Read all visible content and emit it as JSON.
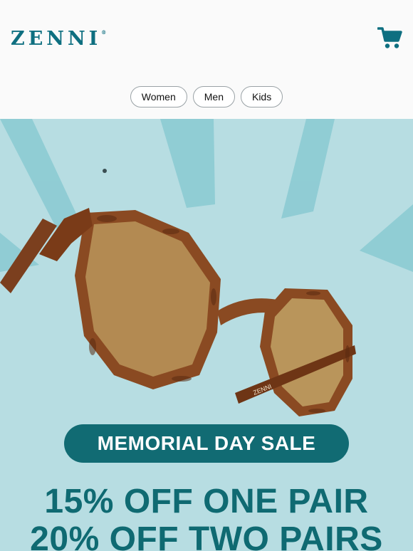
{
  "brand": {
    "logo_text": "ZENNI",
    "trademark": "®",
    "accent_color": "#0e6f80"
  },
  "header": {
    "cart_icon": "shopping-cart-icon"
  },
  "nav": {
    "items": [
      {
        "label": "Women"
      },
      {
        "label": "Men"
      },
      {
        "label": "Kids"
      }
    ]
  },
  "hero": {
    "product_image": "tortoise-hexagon-sunglasses",
    "frame_engraving": "ZENNI",
    "sale_title": "MEMORIAL DAY SALE",
    "offer_line_1": "15% OFF ONE PAIR",
    "offer_line_2": "20% OFF TWO PAIRS",
    "background_color": "#b7dde2",
    "sale_pill_color": "#116b73",
    "offer_text_color": "#0f6a72"
  }
}
